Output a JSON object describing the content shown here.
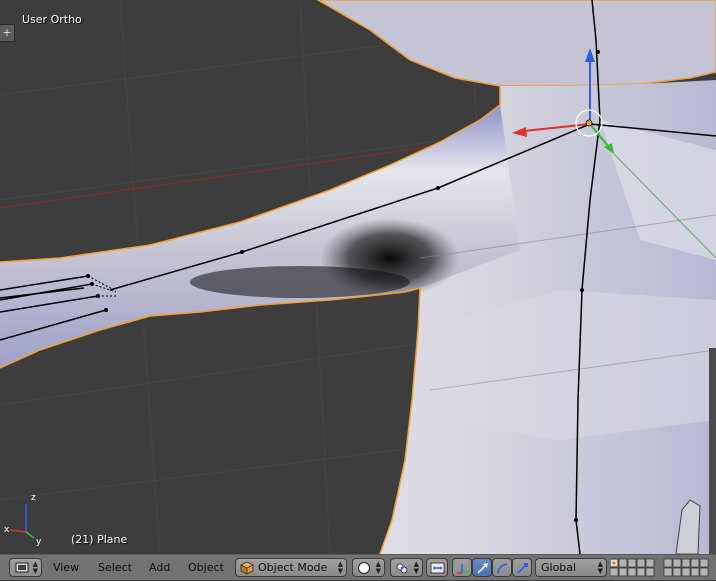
{
  "viewport": {
    "view_name": "User Ortho",
    "object_info": "(21) Plane",
    "add_region_symbol": "+"
  },
  "header": {
    "editor_type_icon": "3d-view-icon",
    "menus": [
      "View",
      "Select",
      "Add",
      "Object"
    ],
    "mode": {
      "icon": "cube-icon",
      "label": "Object Mode"
    },
    "shading": {
      "icon": "solid-sphere-icon"
    },
    "pivot": {
      "icon": "pivot-point-icon"
    },
    "manipulator_toggle_icon": "manipulator-icon",
    "transform_icons": [
      "translate-icon",
      "rotate-icon",
      "scale-icon"
    ],
    "orientation": {
      "label": "Global"
    },
    "layers_icon": "layer-grid-icon"
  },
  "colors": {
    "viewport_bg": "#3d3d3d",
    "header_bg": "#727272",
    "selection_outline": "#f0a030",
    "axis_x": "#e03030",
    "axis_y": "#30c030",
    "axis_z": "#3060e0"
  }
}
